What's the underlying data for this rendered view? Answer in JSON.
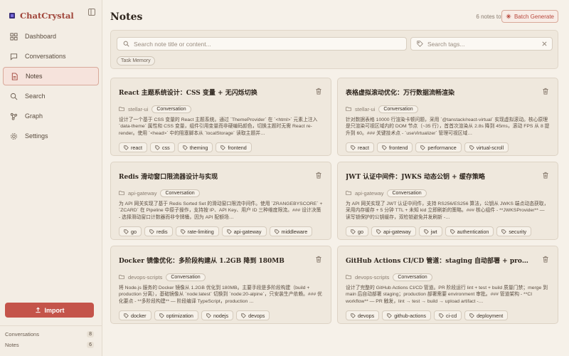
{
  "app": {
    "name": "ChatCrystal"
  },
  "sidebar": {
    "items": [
      {
        "label": "Dashboard",
        "icon": "dashboard-icon",
        "active": false
      },
      {
        "label": "Conversations",
        "icon": "chat-bubble-icon",
        "active": false
      },
      {
        "label": "Notes",
        "icon": "note-icon",
        "active": true
      },
      {
        "label": "Search",
        "icon": "search-icon",
        "active": false
      },
      {
        "label": "Graph",
        "icon": "graph-icon",
        "active": false
      },
      {
        "label": "Settings",
        "icon": "gear-icon",
        "active": false
      }
    ],
    "import_label": "Import",
    "stats": [
      {
        "label": "Conversations",
        "count": "8"
      },
      {
        "label": "Notes",
        "count": "6"
      }
    ]
  },
  "header": {
    "title": "Notes",
    "total": "6 notes total",
    "batch_label": "Batch Generate"
  },
  "filters": {
    "note_placeholder": "Search note title or content...",
    "tags_placeholder": "Search tags...",
    "memory_tag": "Task Memory"
  },
  "notes": [
    {
      "title": "React 主题系统设计：CSS 变量 + 无闪烁切换",
      "source": "stellar-ui",
      "type": "Conversation",
      "excerpt": "设计了一个基于 CSS 变量的 React 主题系统。通过 `ThemeProvider` 在 `<html>` 元素上注入 `data-theme` 属性和 CSS 变量，组件引用变量而非硬编码颜色，切换主题时无需 React re-render。使用 `<head>` 中的阻塞脚本从 `localStorage` 读取主题并…",
      "tags": [
        "react",
        "css",
        "theming",
        "frontend"
      ]
    },
    {
      "title": "表格虚拟滚动优化：万行数据流畅渲染",
      "source": "stellar-ui",
      "type": "Conversation",
      "excerpt": "针对数据表格 10000 行渲染卡顿问题，采用 `@tanstack/react-virtual` 实现虚拟滚动。核心原理是只渲染可视区域内的 DOM 节点（~35 行），首首次渲染从 2.8s 降到 45ms，滚动 FPS 从 8 提升到 60。### 关键技术点 - `useVirtualizer` 管理可视区域…",
      "tags": [
        "react",
        "frontend",
        "performance",
        "virtual-scroll"
      ]
    },
    {
      "title": "Redis 滑动窗口限流器设计与实现",
      "source": "api-gateway",
      "type": "Conversation",
      "excerpt": "为 API 网关实现了基于 Redis Sorted Set 的滑动窗口限流中间件。使用 `ZRANGEBYSCORE` + `ZCARD` 在 Pipeline 中原子操作，支持按 IP、API Key、用户 ID 三种维度限流。### 设计决策 - 选择滑动窗口计数器而非令牌桶，因为 API 配额场…",
      "tags": [
        "go",
        "redis",
        "rate-limiting",
        "api-gateway",
        "middleware"
      ]
    },
    {
      "title": "JWT 认证中间件：JWKS 动态公钥 + 缓存策略",
      "source": "api-gateway",
      "type": "Conversation",
      "excerpt": "为 API 网关实现了 JWT 认证中间件，支持 RS256/ES256 算法，公钥从 JWKS 端点动态获取，采用内存缓存 + 5 分钟 TTL + 未知 kid 立即刷新的策略。### 核心组件 - **JWKSProvider** — 读写锁保护的公钥缓存，双检锁避免并发刷新 -…",
      "tags": [
        "go",
        "api-gateway",
        "jwt",
        "authentication",
        "security"
      ]
    },
    {
      "title": "Docker 镜像优化：多阶段构建从 1.2GB 降到 180MB",
      "source": "devops-scripts",
      "type": "Conversation",
      "excerpt": "将 Node.js 服务的 Docker 镜像从 1.2GB 优化到 180MB。主要手段是多阶段构建（build + production 分离），基础镜像从 `node:latest` 切换到 `node:20-alpine`，只安装生产依赖。### 优化要点 - **多阶段构建** — 阶段编译 TypeScript，production …",
      "tags": [
        "docker",
        "optimization",
        "nodejs",
        "devops"
      ]
    },
    {
      "title": "GitHub Actions CI/CD 管道：staging 自动部署 + production …",
      "source": "devops-scripts",
      "type": "Conversation",
      "excerpt": "设计了完整的 GitHub Actions CI/CD 管道。PR 阶段运行 lint + test + build 质量门禁；merge 到 main 后自动部署 staging；production 部署需要 environment 审批。### 管道架构 - **CI workflow** — PR 触发，lint → test → build → upload artifact -…",
      "tags": [
        "devops",
        "github-actions",
        "ci-cd",
        "deployment"
      ]
    }
  ]
}
